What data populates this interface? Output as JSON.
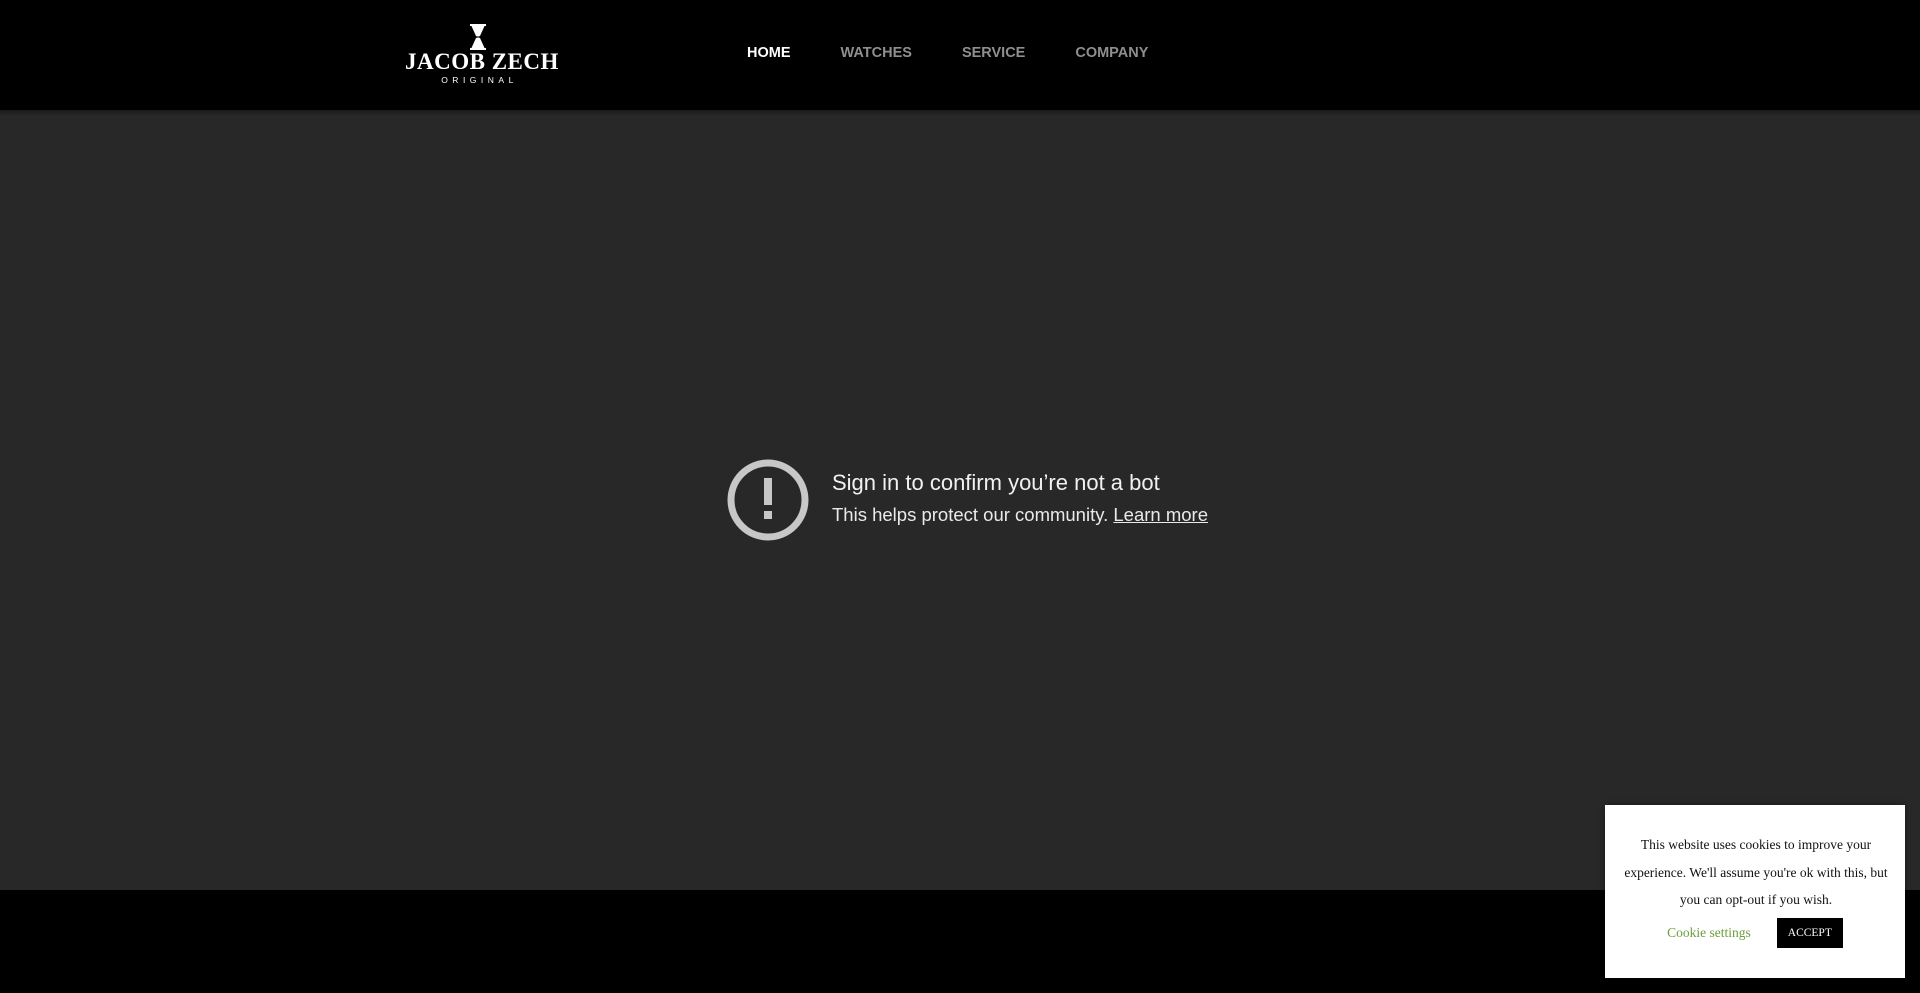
{
  "header": {
    "logo": {
      "name": "JACOB ZECH",
      "sub": "ORIGINAL"
    },
    "nav": [
      {
        "label": "HOME",
        "active": true
      },
      {
        "label": "WATCHES",
        "active": false
      },
      {
        "label": "SERVICE",
        "active": false
      },
      {
        "label": "COMPANY",
        "active": false
      }
    ]
  },
  "video": {
    "icon": "exclamation-circle-icon",
    "title": "Sign in to confirm you’re not a bot",
    "body": "This helps protect our community.",
    "link": "Learn more"
  },
  "cookie": {
    "text": "This website uses cookies to improve your experience. We'll assume you're ok with this, but you can opt-out if you wish.",
    "settings_label": "Cookie settings",
    "accept_label": "ACCEPT",
    "settings_color": "#6c9e3c"
  },
  "colors": {
    "page_bg": "#000000",
    "video_bg": "#282828",
    "nav_active": "#ffffff",
    "nav_inactive": "#8f8f8f"
  }
}
